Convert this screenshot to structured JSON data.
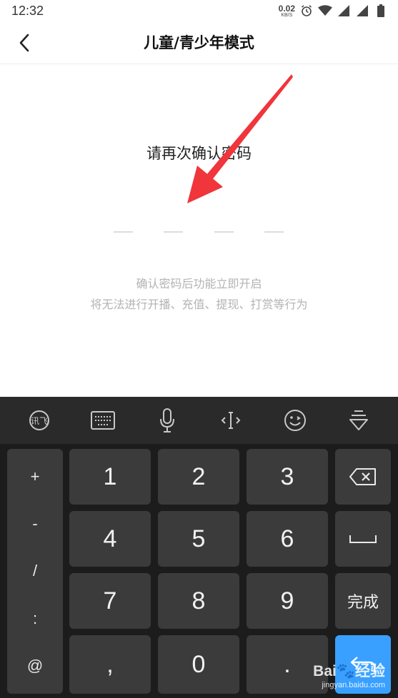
{
  "status_bar": {
    "time": "12:32",
    "net_speed_value": "0.02",
    "net_speed_unit": "KB/S",
    "icons": [
      "alarm-icon",
      "wifi-icon",
      "signal-icon",
      "signal-icon",
      "battery-icon"
    ]
  },
  "header": {
    "back_icon": "chevron-left-icon",
    "title": "儿童/青少年模式"
  },
  "content": {
    "prompt": "请再次确认密码",
    "pin_length": 4,
    "hint_line1": "确认密码后功能立即开启",
    "hint_line2": "将无法进行开播、充值、提现、打赏等行为"
  },
  "annotation": {
    "color": "#f0353b"
  },
  "keyboard": {
    "toolbar": [
      "xunfei-logo-icon",
      "keyboard-icon",
      "microphone-icon",
      "cursor-move-icon",
      "emoji-icon",
      "collapse-keyboard-icon"
    ],
    "symbols": [
      "+",
      "-",
      "/",
      ":",
      "@"
    ],
    "digits": {
      "k1": "1",
      "k2": "2",
      "k3": "3",
      "k4": "4",
      "k5": "5",
      "k6": "6",
      "k7": "7",
      "k8": "8",
      "k9": "9",
      "k0": "0"
    },
    "comma": ",",
    "period": ".",
    "done_label": "完成",
    "backspace_icon": "backspace-icon",
    "space_icon": "space-icon",
    "enter_icon": "enter-icon",
    "accent_color": "#3aa0ff"
  },
  "watermark": {
    "brand": "Bai",
    "brand_suffix": "经验",
    "site": "jingyan.baidu.com"
  }
}
